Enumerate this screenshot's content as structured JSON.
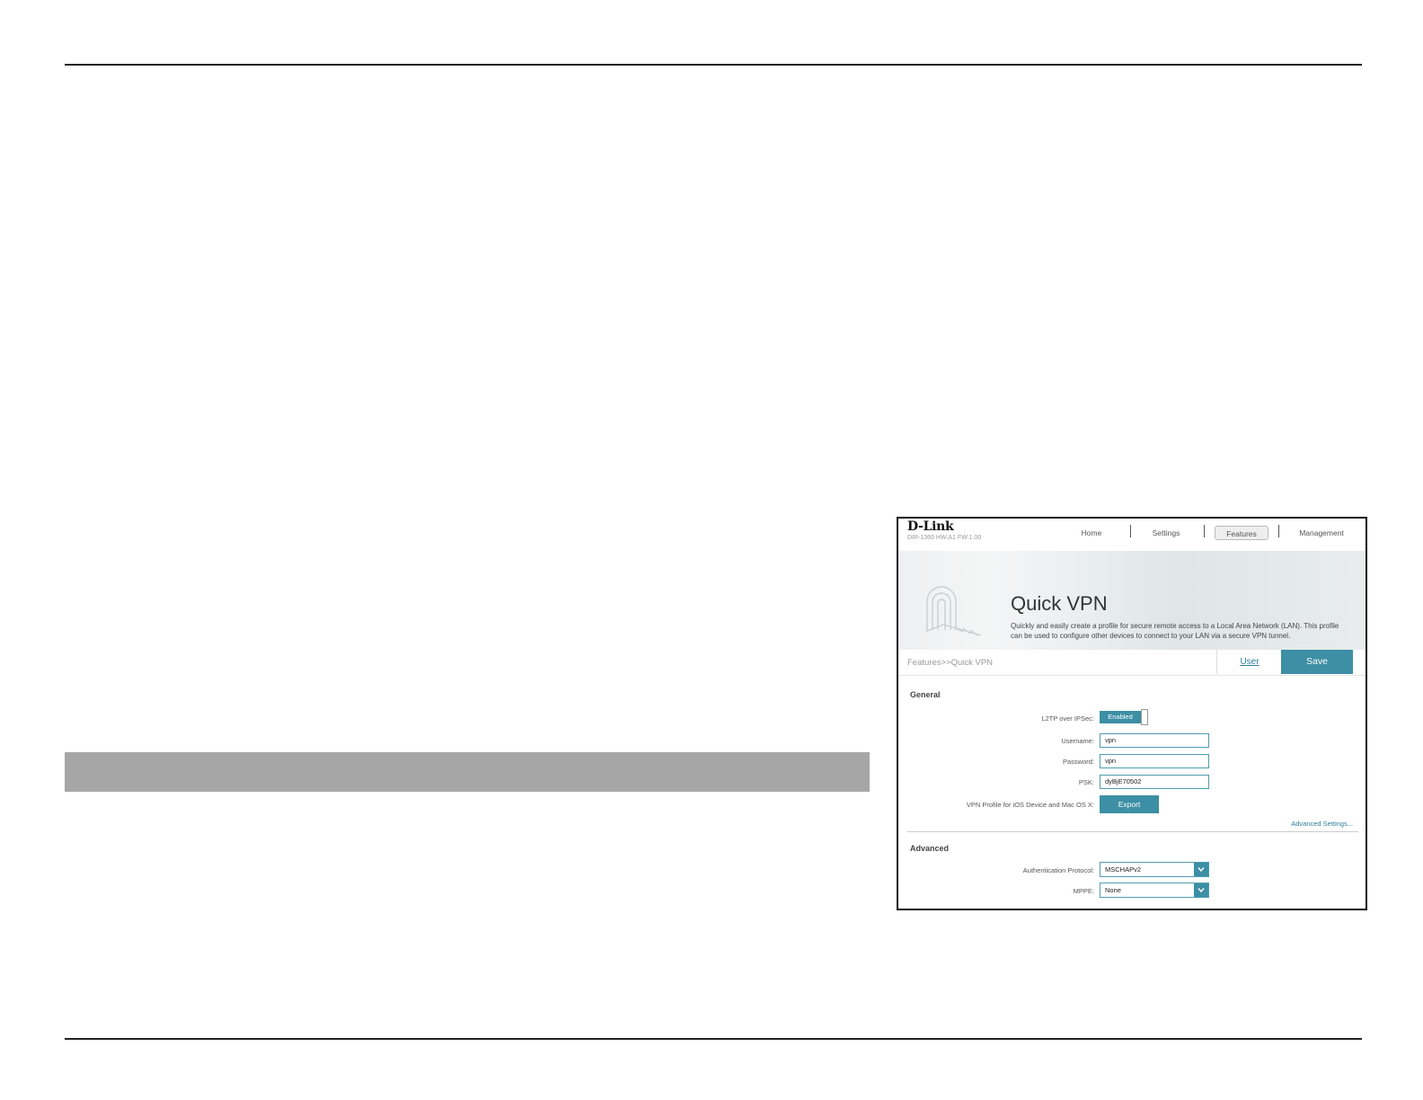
{
  "app": {
    "logo": "D-Link",
    "model": "DIR-1360 HW:A1 FW:1.00",
    "nav": [
      {
        "label": "Home",
        "active": false
      },
      {
        "label": "Settings",
        "active": false
      },
      {
        "label": "Features",
        "active": true
      },
      {
        "label": "Management",
        "active": false
      }
    ]
  },
  "banner": {
    "title": "Quick VPN",
    "description": "Quickly and easily create a profile for secure remote access to a Local Area Network (LAN). This profile can be used to configure other devices to connect to your LAN via a secure VPN tunnel."
  },
  "breadcrumb": "Features>>Quick VPN",
  "actions": {
    "user_label": "User",
    "save_label": "Save"
  },
  "general": {
    "title": "General",
    "l2tp_label": "L2TP over IPSec:",
    "l2tp_state": "Enabled",
    "username_label": "Username:",
    "username_value": "vpn",
    "password_label": "Password:",
    "password_value": "vpn",
    "psk_label": "PSK:",
    "psk_value": "dyBjE70502",
    "vpn_profile_label": "VPN Profile for iOS Device and Mac OS X:",
    "export_label": "Export",
    "advanced_link": "Advanced Settings..."
  },
  "advanced": {
    "title": "Advanced",
    "auth_label": "Authentication Protocol:",
    "auth_value": "MSCHAPv2",
    "mppe_label": "MPPE:",
    "mppe_value": "None"
  },
  "colors": {
    "accent": "#3c8fa4",
    "link": "#2e7d9a",
    "page_bar": "#a6a6a6"
  }
}
